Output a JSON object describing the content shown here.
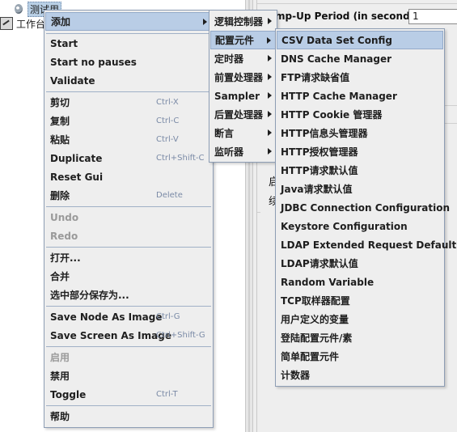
{
  "tree": {
    "test_plan_label": "测试用",
    "workbench_label": "工作台"
  },
  "right_panel": {
    "ramp_up_label": "mp-Up Period (in seconds):",
    "ramp_up_value": "1",
    "frag_1": "启",
    "frag_2": "续"
  },
  "context_menu": {
    "items": [
      {
        "label": "添加",
        "shortcut": ""
      },
      {
        "label": "Start",
        "shortcut": ""
      },
      {
        "label": "Start no pauses",
        "shortcut": ""
      },
      {
        "label": "Validate",
        "shortcut": ""
      },
      {
        "label": "剪切",
        "shortcut": "Ctrl-X"
      },
      {
        "label": "复制",
        "shortcut": "Ctrl-C"
      },
      {
        "label": "粘贴",
        "shortcut": "Ctrl-V"
      },
      {
        "label": "Duplicate",
        "shortcut": "Ctrl+Shift-C"
      },
      {
        "label": "Reset Gui",
        "shortcut": ""
      },
      {
        "label": "删除",
        "shortcut": "Delete"
      },
      {
        "label": "Undo",
        "shortcut": ""
      },
      {
        "label": "Redo",
        "shortcut": ""
      },
      {
        "label": "打开...",
        "shortcut": ""
      },
      {
        "label": "合并",
        "shortcut": ""
      },
      {
        "label": "选中部分保存为...",
        "shortcut": ""
      },
      {
        "label": "Save Node As Image",
        "shortcut": "Ctrl-G"
      },
      {
        "label": "Save Screen As Image",
        "shortcut": "Ctrl+Shift-G"
      },
      {
        "label": "启用",
        "shortcut": ""
      },
      {
        "label": "禁用",
        "shortcut": ""
      },
      {
        "label": "Toggle",
        "shortcut": "Ctrl-T"
      },
      {
        "label": "帮助",
        "shortcut": ""
      }
    ]
  },
  "add_submenu": {
    "items": [
      {
        "label": "逻辑控制器"
      },
      {
        "label": "配置元件"
      },
      {
        "label": "定时器"
      },
      {
        "label": "前置处理器"
      },
      {
        "label": "Sampler"
      },
      {
        "label": "后置处理器"
      },
      {
        "label": "断言"
      },
      {
        "label": "监听器"
      }
    ]
  },
  "config_submenu": {
    "items": [
      {
        "label": "CSV Data Set Config"
      },
      {
        "label": "DNS Cache Manager"
      },
      {
        "label": "FTP请求缺省值"
      },
      {
        "label": "HTTP Cache Manager"
      },
      {
        "label": "HTTP Cookie 管理器"
      },
      {
        "label": "HTTP信息头管理器"
      },
      {
        "label": "HTTP授权管理器"
      },
      {
        "label": "HTTP请求默认值"
      },
      {
        "label": "Java请求默认值"
      },
      {
        "label": "JDBC Connection Configuration"
      },
      {
        "label": "Keystore Configuration"
      },
      {
        "label": "LDAP Extended Request Defaults"
      },
      {
        "label": "LDAP请求默认值"
      },
      {
        "label": "Random Variable"
      },
      {
        "label": "TCP取样器配置"
      },
      {
        "label": "用户定义的变量"
      },
      {
        "label": "登陆配置元件/素"
      },
      {
        "label": "简单配置元件"
      },
      {
        "label": "计数器"
      }
    ]
  },
  "colors": {
    "menu_bg": "#eeeeee",
    "highlight": "#b9cde6",
    "border": "#8d9db4",
    "disabled_text": "#9a9a9a",
    "shortcut_text": "#7a8aa6"
  }
}
